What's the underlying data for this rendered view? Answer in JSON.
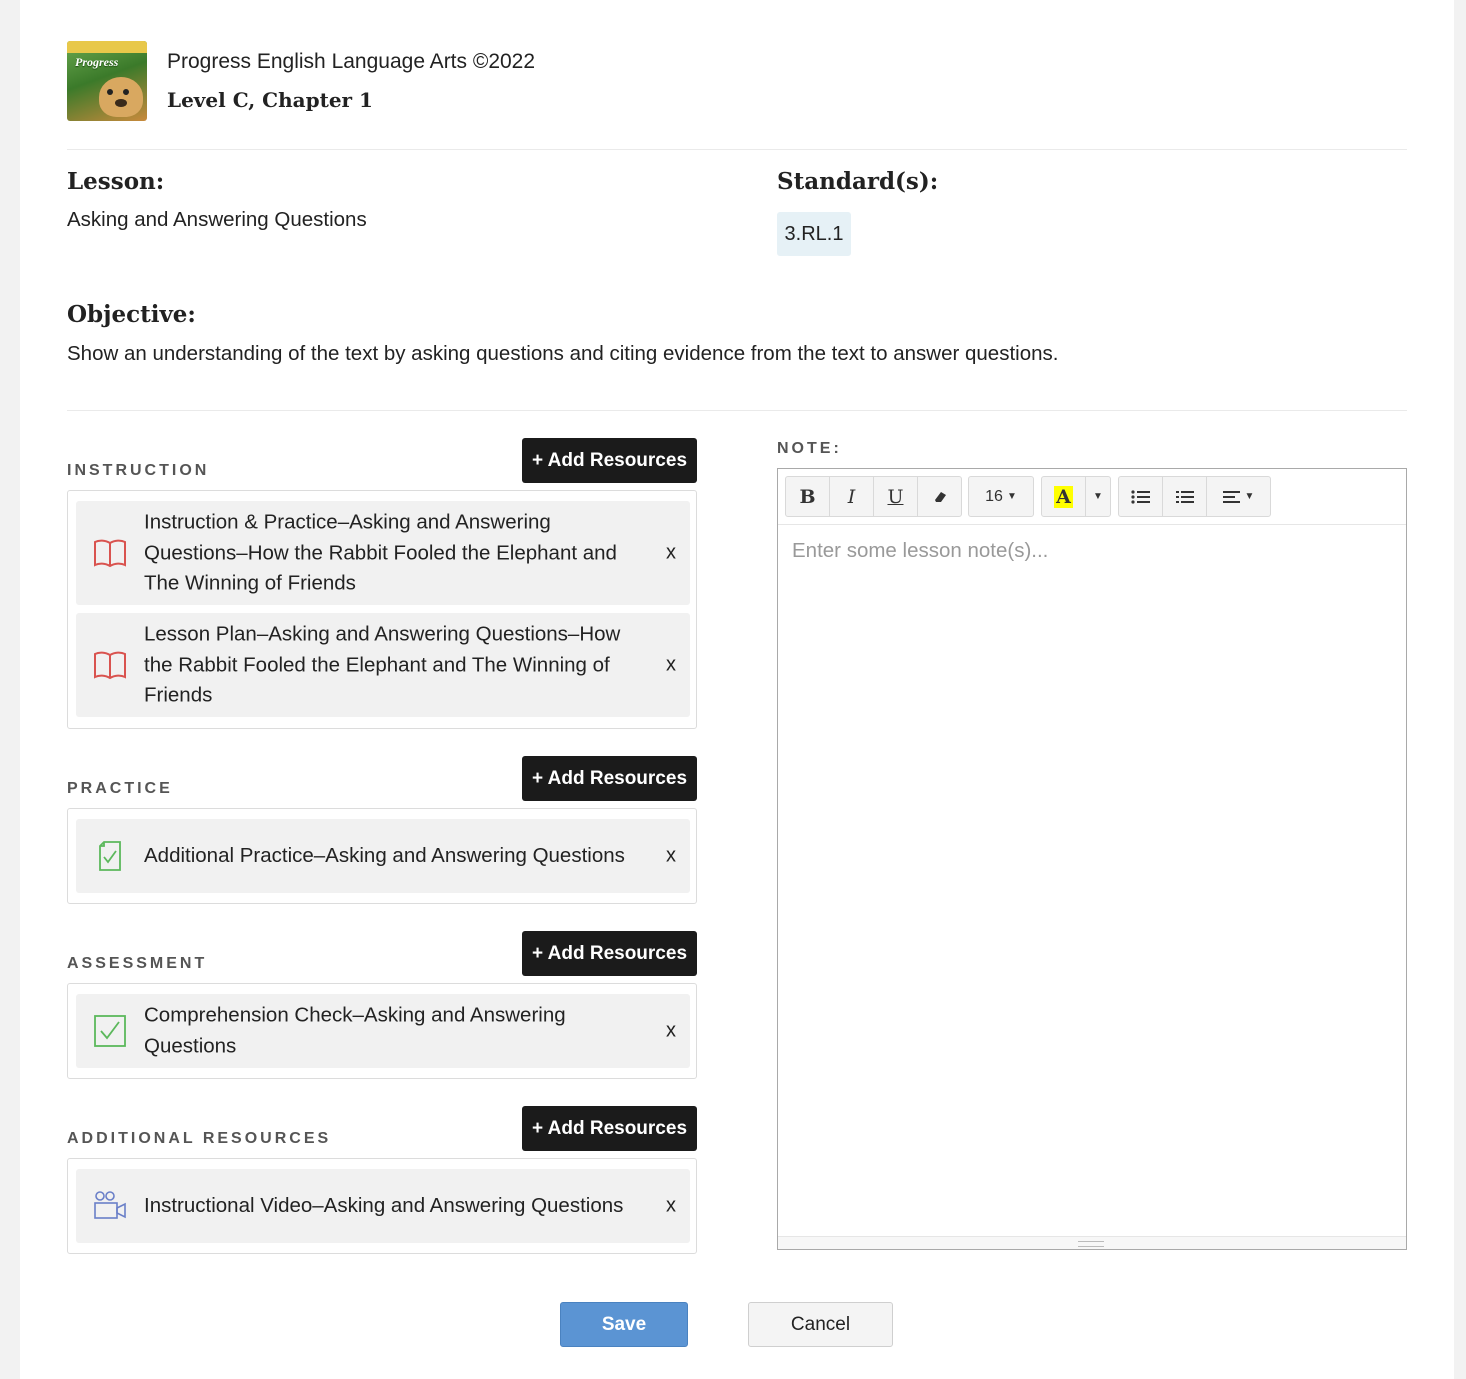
{
  "book": {
    "title": "Progress English Language Arts ©2022",
    "chapter": "Level C, Chapter 1",
    "cover_text": "Progress"
  },
  "lesson": {
    "label": "Lesson:",
    "value": "Asking and Answering Questions"
  },
  "standards": {
    "label": "Standard(s):",
    "items": [
      "3.RL.1"
    ]
  },
  "objective": {
    "label": "Objective:",
    "value": "Show an understanding of the text by asking questions and citing evidence from the text to answer questions."
  },
  "sections": [
    {
      "label": "INSTRUCTION",
      "button": "+ Add Resources",
      "items": [
        {
          "icon": "book-icon",
          "text": "Instruction & Practice–Asking and Answering Questions–How the Rabbit Fooled the Elephant and The Winning of Friends",
          "remove": "x"
        },
        {
          "icon": "book-icon",
          "text": "Lesson Plan–Asking and Answering Questions–How the Rabbit Fooled the Elephant and The Winning of Friends",
          "remove": "x"
        }
      ]
    },
    {
      "label": "PRACTICE",
      "button": "+ Add Resources",
      "items": [
        {
          "icon": "clipboard-check-icon",
          "text": "Additional Practice–Asking and Answering Questions",
          "remove": "x"
        }
      ]
    },
    {
      "label": "ASSESSMENT",
      "button": "+ Add Resources",
      "items": [
        {
          "icon": "checkbox-icon",
          "text": "Comprehension Check–Asking and Answering Questions",
          "remove": "x"
        }
      ]
    },
    {
      "label": "ADDITIONAL RESOURCES",
      "button": "+ Add Resources",
      "items": [
        {
          "icon": "video-camera-icon",
          "text": "Instructional Video–Asking and Answering Questions",
          "remove": "x"
        }
      ]
    }
  ],
  "note": {
    "label": "NOTE:",
    "placeholder": "Enter some lesson note(s)...",
    "toolbar": {
      "bold": "B",
      "italic": "I",
      "underline": "U",
      "font_size": "16",
      "highlight": "A"
    }
  },
  "actions": {
    "save": "Save",
    "cancel": "Cancel"
  },
  "colors": {
    "button_dark": "#1b1b1b",
    "save_blue": "#5b94d3",
    "standard_badge": "#e6f1f6",
    "book_icon": "#d9534f",
    "check_icon": "#5cb85c",
    "video_icon": "#6a7fc8",
    "highlight_yellow": "#ffff00"
  }
}
